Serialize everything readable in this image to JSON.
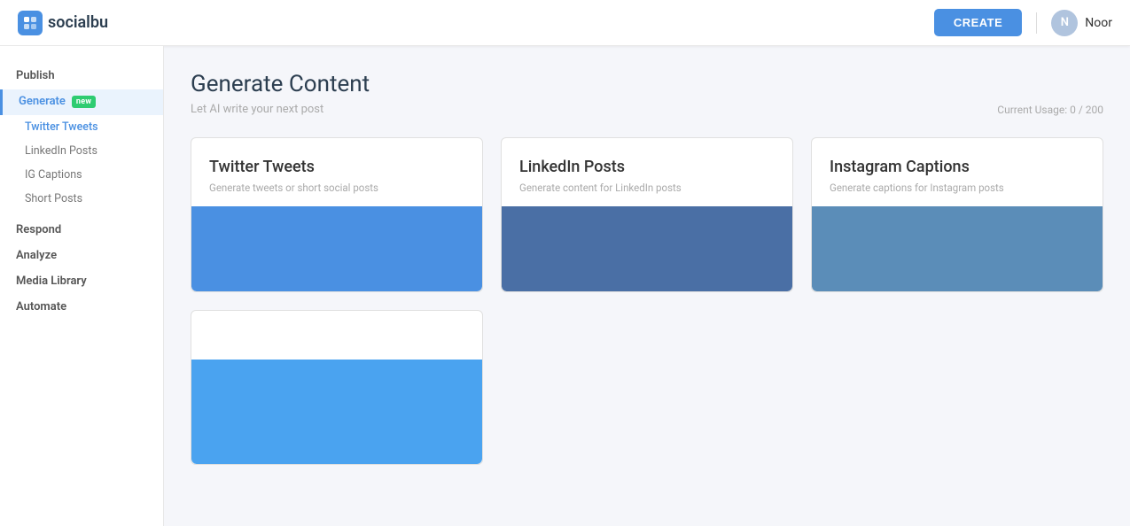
{
  "navbar": {
    "logo_text": "socialbu",
    "logo_icon": "S",
    "create_label": "CREATE",
    "user_name": "Noor",
    "user_initial": "N"
  },
  "sidebar": {
    "publish_label": "Publish",
    "generate_label": "Generate",
    "new_badge": "new",
    "twitter_tweets_label": "Twitter Tweets",
    "linkedin_posts_label": "LinkedIn Posts",
    "ig_captions_label": "IG Captions",
    "short_posts_label": "Short Posts",
    "respond_label": "Respond",
    "analyze_label": "Analyze",
    "media_library_label": "Media Library",
    "automate_label": "Automate"
  },
  "page": {
    "title": "Generate Content",
    "subtitle": "Let AI write your next post",
    "usage_label": "Current Usage: 0 / 200"
  },
  "cards": [
    {
      "id": "twitter",
      "title": "Twitter Tweets",
      "desc": "Generate tweets or short social posts",
      "color": "twitter-color"
    },
    {
      "id": "linkedin",
      "title": "LinkedIn Posts",
      "desc": "Generate content for LinkedIn posts",
      "color": "linkedin-color"
    },
    {
      "id": "instagram",
      "title": "Instagram Captions",
      "desc": "Generate captions for Instagram posts",
      "color": "instagram-color"
    }
  ],
  "cards_row2": [
    {
      "id": "short",
      "title": "",
      "desc": "",
      "color": "short-color"
    }
  ]
}
